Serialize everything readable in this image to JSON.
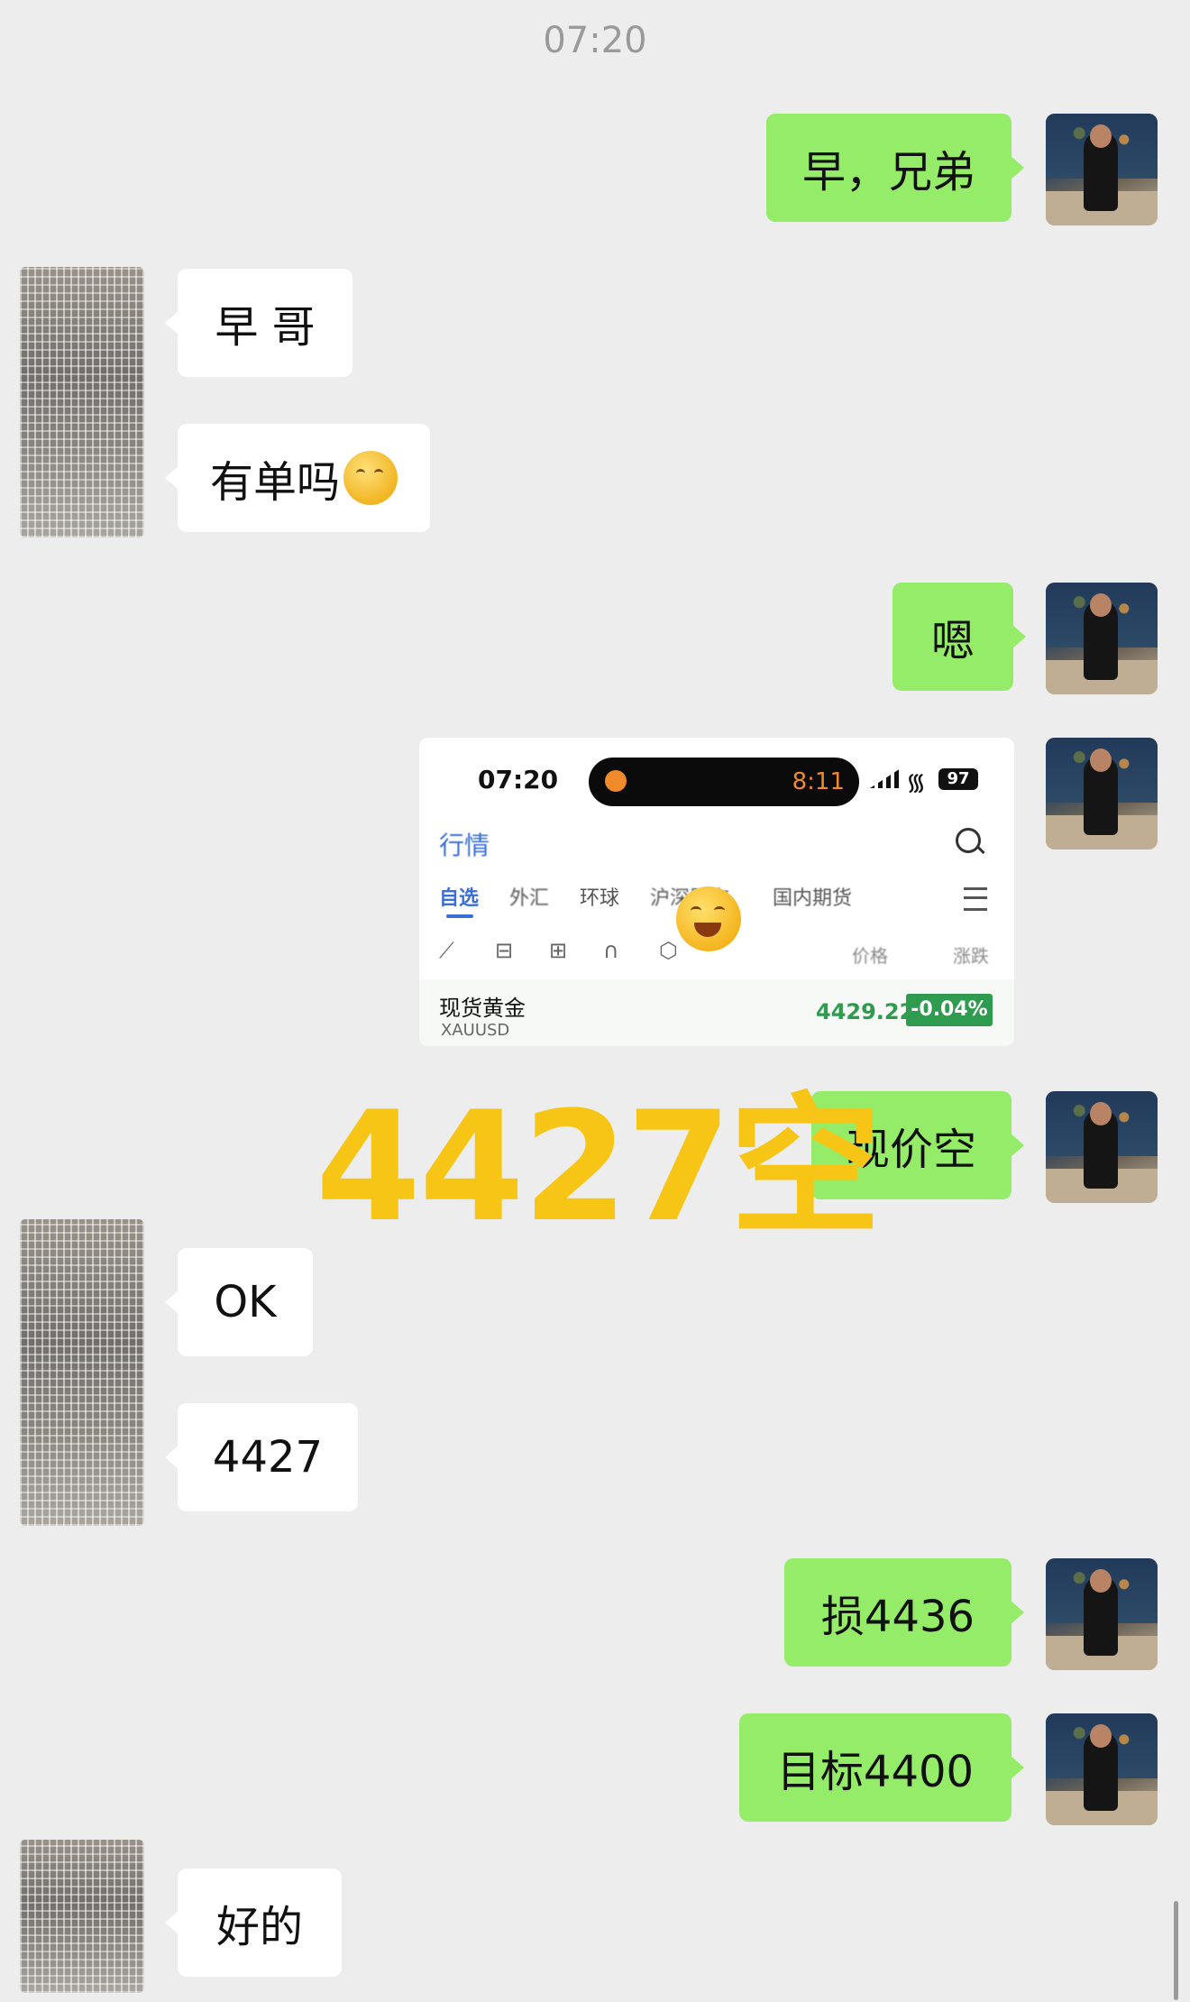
{
  "chat": {
    "timestamp": "07:20",
    "messages": [
      {
        "side": "right",
        "text": "早，兄弟"
      },
      {
        "side": "left",
        "text": "早 哥"
      },
      {
        "side": "left",
        "text": "有单吗",
        "emoji": "hand-over-mouth-emoji"
      },
      {
        "side": "right",
        "text": "嗯"
      },
      {
        "side": "right",
        "type": "image"
      },
      {
        "side": "right",
        "text": "现价空"
      },
      {
        "side": "left",
        "text": "OK"
      },
      {
        "side": "left",
        "text": "4427"
      },
      {
        "side": "right",
        "text": "损4436"
      },
      {
        "side": "right",
        "text": "目标4400"
      },
      {
        "side": "left",
        "text": "好的"
      }
    ],
    "overlay_text": "4427空"
  },
  "screenshot": {
    "status_time": "07:20",
    "island_time": "8:11",
    "battery": "97",
    "section_title": "行情",
    "tabs": [
      "自选",
      "外汇",
      "环球",
      "沪深股市",
      "国内期货"
    ],
    "column_price": "价格",
    "column_change": "涨跌",
    "quote": {
      "name": "现货黄金",
      "code": "XAUUSD",
      "price": "4429.22",
      "change_pct": "-0.04%"
    }
  },
  "colors": {
    "sent_bubble": "#95ec69",
    "received_bubble": "#ffffff",
    "background": "#ededed",
    "overlay": "#f7c515",
    "quote_down": "#2e9b4e"
  }
}
